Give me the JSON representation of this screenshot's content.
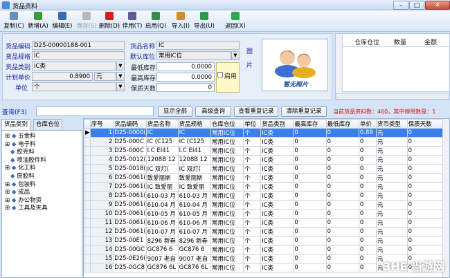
{
  "window": {
    "title": "货品资料",
    "min": "–",
    "max": "□",
    "close": "✕"
  },
  "toolbar": [
    {
      "label": "复制(C)",
      "icon": "copy-icon",
      "color": "#6a8fbf",
      "enabled": true
    },
    {
      "label": "新增(A)",
      "icon": "add-icon",
      "color": "#3a9a3a",
      "enabled": true
    },
    {
      "label": "编辑(E)",
      "icon": "edit-icon",
      "color": "#3a6ab8",
      "enabled": true
    },
    {
      "label": "保存(S)",
      "icon": "save-icon",
      "color": "#b8b8b8",
      "enabled": false
    },
    {
      "label": "删除(D)",
      "icon": "delete-icon",
      "color": "#d02020",
      "enabled": true
    },
    {
      "label": "停用(T)",
      "icon": "disable-icon",
      "color": "#5a5a9a",
      "enabled": true
    },
    {
      "label": "启用(Q)",
      "icon": "enable-icon",
      "color": "#3a8a4a",
      "enabled": true
    },
    {
      "label": "导入(I)",
      "icon": "import-icon",
      "color": "#d09020",
      "enabled": true
    },
    {
      "label": "导出(U)",
      "icon": "export-icon",
      "color": "#2a9a4a",
      "enabled": true
    },
    {
      "label": "返回(X)",
      "icon": "return-icon",
      "color": "#2aa84a",
      "enabled": true
    }
  ],
  "form": {
    "code_label": "货品编码",
    "code_value": "D25-00000188-001",
    "spec_label": "货品规格",
    "spec_value": "IC",
    "cat_label": "货品类别",
    "cat_value": "IC类",
    "price_label": "计划单价",
    "price_value": "0.8900",
    "currency_value": "元",
    "unit_label": "单位",
    "unit_value": "个",
    "name_label": "货品名称",
    "name_value": "IC",
    "loc_label": "默认库位",
    "loc_value": "常用IC位",
    "min_label": "最低库存",
    "min_value": "0.0000",
    "max_label": "最高库存",
    "max_value": "0.0000",
    "shelf_label": "保质天数",
    "shelf_value": "0",
    "enable_label": "启用",
    "photo_label": "图\n\n片",
    "photo_caption": "暂无照片"
  },
  "side_table": {
    "headers": [
      "仓库仓位",
      "数量",
      "金额"
    ]
  },
  "query": {
    "label": "查询(F3)",
    "buttons": [
      "显示全部",
      "高级查询",
      "查看重复记录",
      "清除重复记录"
    ],
    "status": "当前货品资料数：460，其中停用数是：1"
  },
  "tabs": [
    "货品类别",
    "仓库仓位"
  ],
  "tree": [
    "五金料",
    "电子料",
    "胶壳料",
    "喷油胶件料",
    "化工料",
    "原胶料",
    "包装料",
    "成品",
    "办公物资",
    "工具及夹具"
  ],
  "grid": {
    "headers": [
      "序号",
      "货品编码",
      "货品名称",
      "货品规格",
      "仓库仓位",
      "单位",
      "货品类别",
      "最高库存",
      "最低库存",
      "单价",
      "货币类型",
      "保质天数"
    ],
    "rows": [
      [
        "1",
        "D25-0000(",
        "IC",
        "IC",
        "常用IC位",
        "个",
        "IC类",
        "0",
        "0",
        "0.89",
        "元",
        "0"
      ],
      [
        "2",
        "D25-000C",
        "IC (C125",
        "IC (C125",
        "常用IC位",
        "个",
        "IC类",
        "0",
        "0",
        "0",
        "元",
        "0"
      ],
      [
        "3",
        "D25-000C",
        "I.C EI41",
        "I.C EI41",
        "常用IC位",
        "个",
        "IC类",
        "0",
        "0",
        "0",
        "元",
        "0"
      ],
      [
        "4",
        "D25-0012(",
        "1208B 12",
        "1208B 12",
        "常用IC位",
        "个",
        "IC类",
        "0",
        "0",
        "0",
        "元",
        "0"
      ],
      [
        "5",
        "D25-0018(",
        "IC 双灯(",
        "IC 双灯(",
        "常用IC位",
        "个",
        "IC类",
        "0",
        "0",
        "0",
        "元",
        "0"
      ],
      [
        "6",
        "D25-0061(",
        "致爱丽斯",
        "致爱丽斯",
        "常用IC位",
        "个",
        "IC类",
        "0",
        "0",
        "0",
        "元",
        "0"
      ],
      [
        "7",
        "D25-0061(",
        "IC 致爱丽",
        "IC 致爱丽",
        "常用IC位",
        "个",
        "IC类",
        "0",
        "0",
        "0",
        "元",
        "0"
      ],
      [
        "8",
        "D25-0061(",
        "610-03 月",
        "610-03 月",
        "常用IC位",
        "个",
        "IC类",
        "0",
        "0",
        "0",
        "元",
        "0"
      ],
      [
        "9",
        "D25-0061(",
        "610-04 月",
        "610-04 月",
        "常用IC位",
        "个",
        "IC类",
        "0",
        "0",
        "0",
        "元",
        "0"
      ],
      [
        "10",
        "D25-0061(",
        "610-05 月",
        "610-05 月",
        "常用IC位",
        "个",
        "IC类",
        "0",
        "0",
        "0",
        "元",
        "0"
      ],
      [
        "11",
        "D25-0061(",
        "610-06 月",
        "610-06 月",
        "常用IC位",
        "个",
        "IC类",
        "0",
        "0",
        "0",
        "元",
        "0"
      ],
      [
        "12",
        "D25-0061(",
        "610-07 月",
        "610-07 月",
        "常用IC位",
        "个",
        "IC类",
        "0",
        "0",
        "0",
        "元",
        "0"
      ],
      [
        "13",
        "D25-00E1",
        "8296 新春",
        "8296 新春",
        "常用IC位",
        "个",
        "IC类",
        "0",
        "0",
        "0",
        "元",
        "0"
      ],
      [
        "14",
        "D25-00GC",
        "GC876 6",
        "GC876 6",
        "常用IC位",
        "个",
        "IC类",
        "0",
        "0",
        "0",
        "元",
        "0"
      ],
      [
        "15",
        "D25-0E26(",
        "9007 老自",
        "9007 老自",
        "常用IC位",
        "个",
        "IC类",
        "0",
        "0",
        "0",
        "元",
        "0"
      ],
      [
        "16",
        "D25-0GC8",
        "GC876 6L",
        "GC876 6L",
        "常用IC位",
        "个",
        "IC类",
        "0",
        "0",
        "0",
        "元",
        "0"
      ]
    ]
  },
  "watermark": "3HE 当游网"
}
